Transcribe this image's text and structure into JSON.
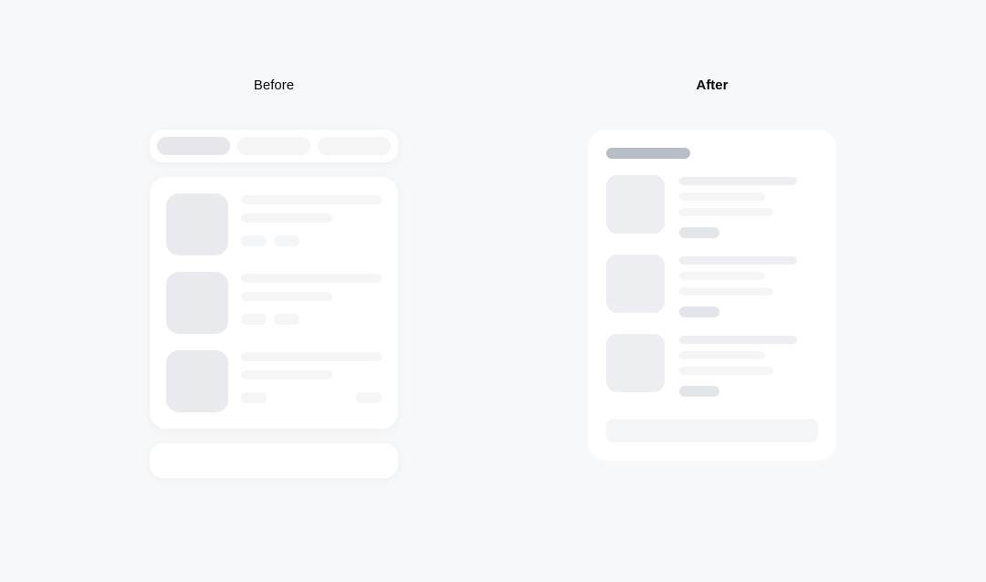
{
  "labels": {
    "before": "Before",
    "after": "After"
  }
}
